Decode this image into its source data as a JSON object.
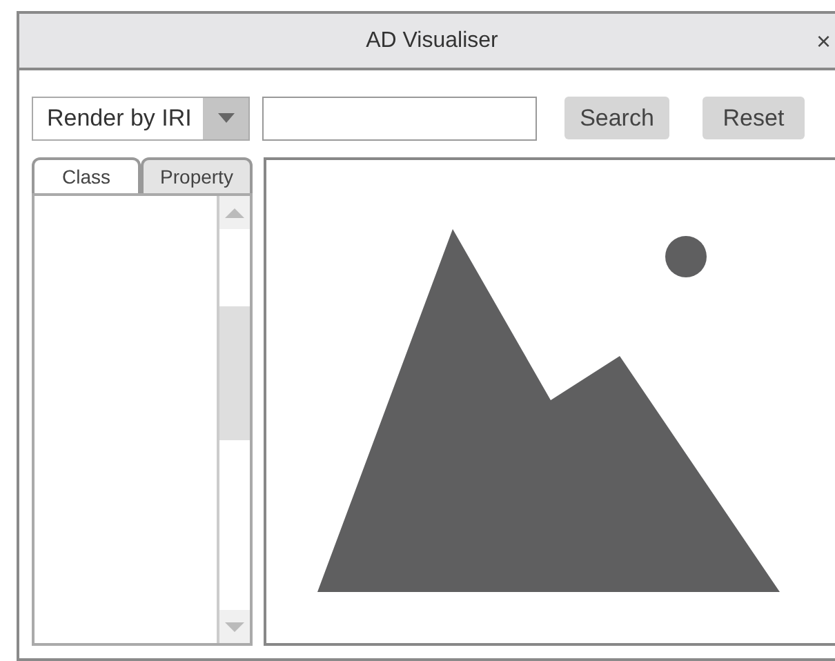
{
  "window": {
    "title": "AD Visualiser",
    "close": "×"
  },
  "toolbar": {
    "render_mode": "Render by IRI",
    "buttons": [
      "Search",
      "Reset"
    ]
  },
  "tabs": [
    {
      "label": "Class",
      "selected": true
    },
    {
      "label": "Property",
      "selected": false
    }
  ]
}
